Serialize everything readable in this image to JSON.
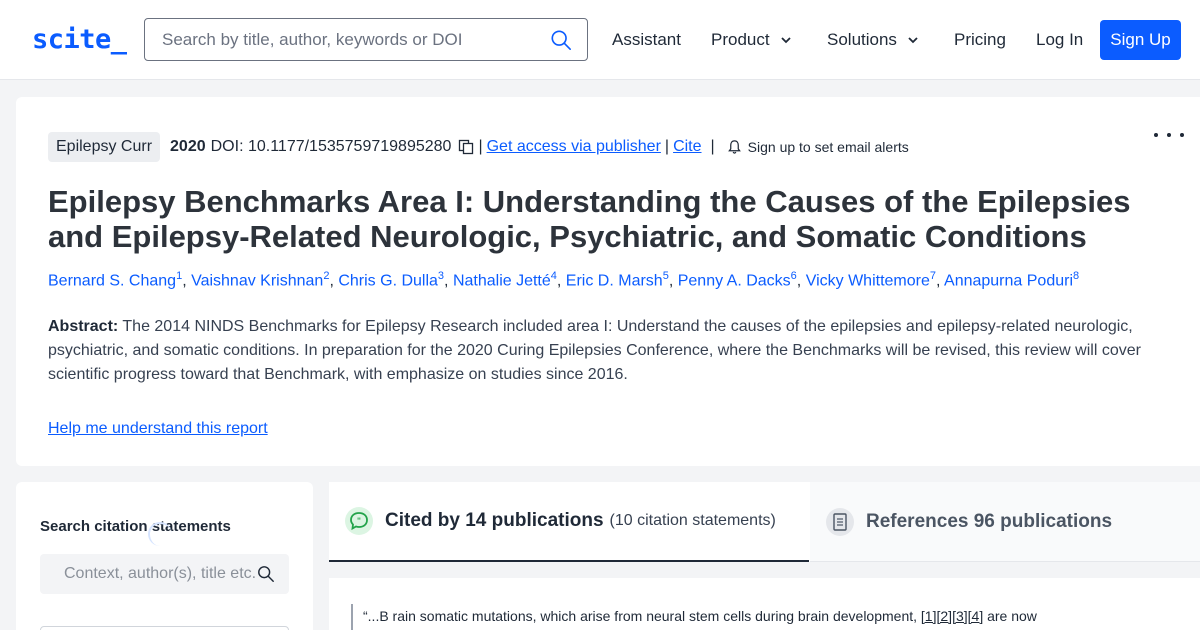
{
  "header": {
    "logo": "scite_",
    "search_placeholder": "Search by title, author, keywords or DOI",
    "nav": {
      "assistant": "Assistant",
      "product": "Product",
      "solutions": "Solutions",
      "pricing": "Pricing",
      "login": "Log In",
      "signup": "Sign Up"
    }
  },
  "paper": {
    "journal": "Epilepsy Curr",
    "year": "2020",
    "doi": "DOI: 10.1177/1535759719895280",
    "access_link": "Get access via publisher",
    "cite_link": "Cite",
    "alerts": "Sign up to set email alerts",
    "title": "Epilepsy Benchmarks Area I: Understanding the Causes of the Epilepsies and Epilepsy-Related Neurologic, Psychiatric, and Somatic Conditions",
    "authors": [
      {
        "name": "Bernard S. Chang",
        "aff": "1"
      },
      {
        "name": "Vaishnav Krishnan",
        "aff": "2"
      },
      {
        "name": "Chris G. Dulla",
        "aff": "3"
      },
      {
        "name": "Nathalie Jetté",
        "aff": "4"
      },
      {
        "name": "Eric D. Marsh",
        "aff": "5"
      },
      {
        "name": "Penny A. Dacks",
        "aff": "6"
      },
      {
        "name": "Vicky Whittemore",
        "aff": "7"
      },
      {
        "name": "Annapurna Poduri",
        "aff": "8"
      }
    ],
    "abstract_label": "Abstract:",
    "abstract_text": " The 2014 NINDS Benchmarks for Epilepsy Research included area I: Understand the causes of the epilepsies and epilepsy-related neurologic, psychiatric, and somatic conditions. In preparation for the 2020 Curing Epilepsies Conference, where the Benchmarks will be revised, this review will cover scientific progress toward that Benchmark, with emphasize on studies since 2016.",
    "help_link": "Help me understand this report"
  },
  "sidebar": {
    "title": "Search citation statements",
    "input_placeholder": "Context, author(s), title etc."
  },
  "tabs": {
    "cited_label": "Cited by 14 publications",
    "cited_sub": "(10 citation statements)",
    "refs_label": "References 96 publications"
  },
  "statement": {
    "before": "“...B rain somatic mutations, which arise from neural stem cells during brain development, ",
    "refs": [
      "[1]",
      "[2]",
      "[3]",
      "[4]"
    ],
    "after": " are now"
  },
  "colors": {
    "accent": "#0b5cff",
    "cited_icon": "#22a34a"
  }
}
